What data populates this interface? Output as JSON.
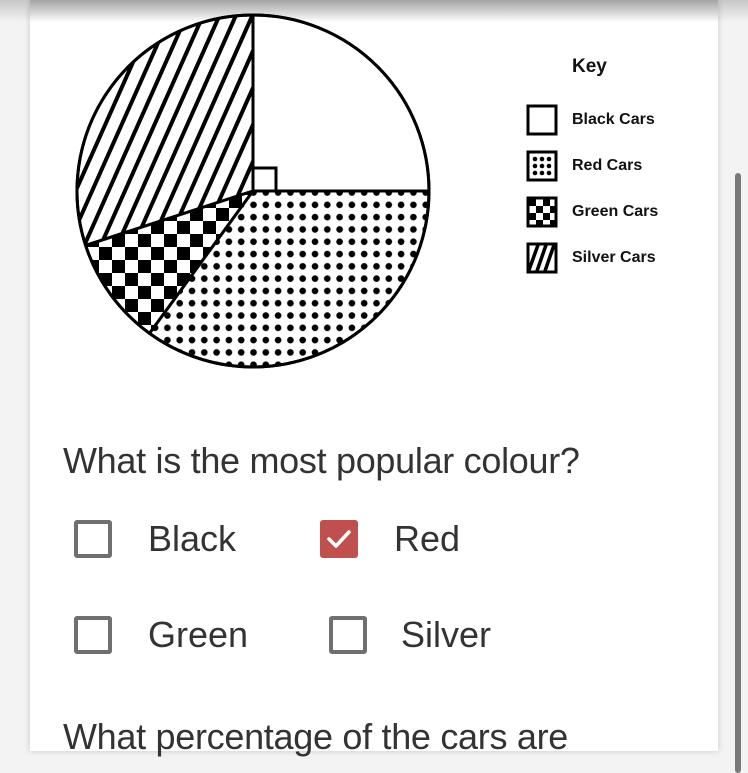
{
  "chart_data": {
    "type": "pie",
    "title": "",
    "legend_title": "Key",
    "legend_position": "right",
    "categories": [
      "Black Cars",
      "Red Cars",
      "Green Cars",
      "Silver Cars"
    ],
    "values": [
      25,
      35,
      10,
      30
    ],
    "unit": "percent",
    "patterns": {
      "Black Cars": "blank",
      "Red Cars": "dots",
      "Green Cars": "checkerboard",
      "Silver Cars": "diagonal-stripes"
    },
    "annotations": [
      "right-angle marker on Black Cars sector"
    ]
  },
  "legend": {
    "title": "Key",
    "items": [
      {
        "label": "Black Cars",
        "pattern": "blank"
      },
      {
        "label": "Red Cars",
        "pattern": "dots"
      },
      {
        "label": "Green Cars",
        "pattern": "checkerboard"
      },
      {
        "label": "Silver Cars",
        "pattern": "diagonal-stripes"
      }
    ]
  },
  "question1": {
    "text": "What is the most popular colour?",
    "options": [
      {
        "label": "Black",
        "checked": false
      },
      {
        "label": "Red",
        "checked": true
      },
      {
        "label": "Green",
        "checked": false
      },
      {
        "label": "Silver",
        "checked": false
      }
    ]
  },
  "question2": {
    "text": "What percentage of the cars are"
  },
  "colors": {
    "checked": "#c0504d",
    "checkbox_border": "#6f6f6f",
    "text": "#333333"
  }
}
